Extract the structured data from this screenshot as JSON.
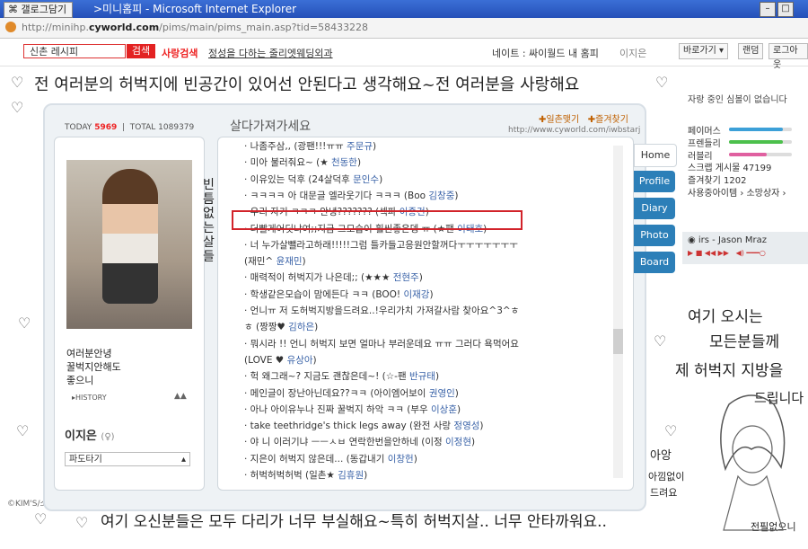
{
  "window": {
    "tab_label": "갤로그담기",
    "title": ">미니홈피 - Microsoft Internet Explorer",
    "url_prefix": "http://minihp.",
    "url_domain": "cyworld.com",
    "url_suffix": "/pims/main/pims_main.asp?tid=58433228",
    "minimize": "–",
    "maximize": "□"
  },
  "toolbar": {
    "search_value": "신촌 레시피",
    "search_button": "검색",
    "people_search": "사랑검색",
    "slogan": "정성을 다하는 줄리엣웨딩외과",
    "nav_links": "네이트 : 싸이월드 내 홈피",
    "nav_user": "이지은",
    "quick_button": "바로가기 ▾",
    "random_button": "랜덤",
    "logout_button": "로그아웃"
  },
  "wall": {
    "top_text": "전 여러분의 허벅지에 빈공간이 있어선 안된다고 생각해요~전 여러분을 사랑해요",
    "bottom_text": "여기 오신분들은 모두 다리가 너무 부실해요~특히 허벅지살.. 너무 안타까워요..",
    "right_text_1": "여기 오시는",
    "right_text_2": "모든분들께",
    "right_text_3": "제 허벅지 지방을",
    "right_text_4": "드립니다",
    "vertical_text": "빈틈없는살들",
    "bottom_left_small": "©KIM'S/소녀의 본능",
    "aang": "아앙",
    "akkim": "아낌없이",
    "deuryeo": "드려요",
    "jeonpil": "전필없으니"
  },
  "hompy": {
    "today_label": "TODAY",
    "today_value": "5969",
    "total_label": "TOTAL",
    "total_value": "1089379",
    "page_title": "살다가져가세요",
    "link_ilchon": "일촌맺기",
    "link_favorite": "즐겨찾기",
    "site_url": "http://www.cyworld.com/iwbstarj",
    "intro_1": "여러분안녕",
    "intro_2": "꿀벅지안해도",
    "intro_3": "좋으니",
    "history": "▸HISTORY",
    "owner": "이지은",
    "owner_icon": "(♀)",
    "select_value": "파도타기"
  },
  "guestbook": [
    {
      "text": "· 나좀주삼,, (광팬!!!ㅠㅠ ",
      "who": "주문규",
      "tail": ")"
    },
    {
      "text": "· 미아 불러줘요~ (★ ",
      "who": "천동한",
      "tail": ")"
    },
    {
      "text": "· 이유있는 덕후 (24살덕후 ",
      "who": "문인수",
      "tail": ")"
    },
    {
      "text": "· ㅋㅋㅋㅋ 아 대문글 엘라웃기다 ㅋㅋㅋ (Boo ",
      "who": "김창중",
      "tail": ")"
    },
    {
      "text": "· 우리 자기 ㅋㅋㅋ 안녕??????? (섹파 ",
      "who": "이종건",
      "tail": ")"
    },
    {
      "text": "· 더빨게어딧냐여;;지금 그모습이 훨씬좋은뎅 ㅠ (★팬 ",
      "who": "이태호",
      "tail": ")"
    },
    {
      "text": "· 너 누가살뺄라고하래!!!!!그럼 틀카들고응원안할꺼다ㅜㅜㅜㅜㅜㅜㅜ",
      "who": "",
      "tail": ""
    },
    {
      "text": "  (재민^ ",
      "who": "윤재민",
      "tail": ")"
    },
    {
      "text": "· 매력적이 허벅지가 나은데;; (★★★ ",
      "who": "전현주",
      "tail": ")"
    },
    {
      "text": "· 학생같은모습이 맘에든다 ㅋㅋ (BOO! ",
      "who": "이재강",
      "tail": ")"
    },
    {
      "text": "· 언니ㅠ 저 도허벅지방을드려요..!우리가치 가져갈사람 찾아요^3^ㅎ",
      "who": "",
      "tail": ""
    },
    {
      "text": "  ㅎ (짱짱♥ ",
      "who": "김하은",
      "tail": ")"
    },
    {
      "text": "· 뭐시라 !! 언니 허벅지 보면 얼마나 부러운데요 ㅠㅠ 그러다 욕먹어요",
      "who": "",
      "tail": ""
    },
    {
      "text": "  (LOVE ♥ ",
      "who": "유상아",
      "tail": ")"
    },
    {
      "text": "· 헉 왜그래~? 지금도 괜찮은데~! (☆-팬 ",
      "who": "반규태",
      "tail": ")"
    },
    {
      "text": "· 메인글이 장난아닌데요??ㅋㅋ (아이엠어보이 ",
      "who": "권영인",
      "tail": ")"
    },
    {
      "text": "· 아나 아이유누나 진짜 꿀벅지 하악 ㅋㅋ (부우 ",
      "who": "이상훈",
      "tail": ")"
    },
    {
      "text": "· take teethridge's thick legs away (완전 사랑 ",
      "who": "정영성",
      "tail": ")"
    },
    {
      "text": "· 야 니 이러기냐 ㅡㅡㅅㅂ 연락한번을안하네 (이정 ",
      "who": "이정현",
      "tail": ")"
    },
    {
      "text": "· 지은이 허벅지 않은데... (동갑내기 ",
      "who": "이창헌",
      "tail": ")"
    },
    {
      "text": "· 허벅허벅허벅 (일촌★ ",
      "who": "김휴원",
      "tail": ")"
    }
  ],
  "tabs": [
    "Home",
    "Profile",
    "Diary",
    "Photo",
    "Board"
  ],
  "sidebar": {
    "status": "자랑 중인 심볼이 없습니다",
    "rows": [
      {
        "label": "페이머스",
        "color": "#3ca0d8",
        "level": 0.85
      },
      {
        "label": "프렌들리",
        "color": "#4cc04c",
        "level": 0.85
      },
      {
        "label": "러블리",
        "color": "#e060a0",
        "level": 0.6
      }
    ],
    "scrap": "스크랩 게시물 47199",
    "favorite": "즐겨찾기 1202",
    "items": "사용중아이템 › 소망상자 ›",
    "music": "irs - Jason Mraz"
  }
}
